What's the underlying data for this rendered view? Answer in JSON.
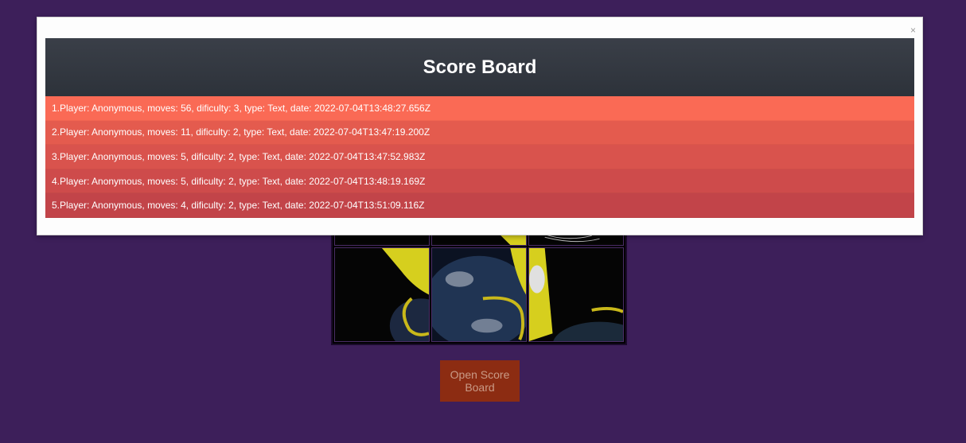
{
  "scoreboard": {
    "title": "Score Board",
    "close_label": "×",
    "row_colors": [
      "#fa6a55",
      "#e45b4e",
      "#d9534d",
      "#ce4b4b",
      "#c24449"
    ],
    "entries": [
      "1.Player: Anonymous, moves: 56, dificulty: 3, type: Text, date: 2022-07-04T13:48:27.656Z",
      "2.Player: Anonymous, moves: 11, dificulty: 2, type: Text, date: 2022-07-04T13:47:19.200Z",
      "3.Player: Anonymous, moves: 5, dificulty: 2, type: Text, date: 2022-07-04T13:47:52.983Z",
      "4.Player: Anonymous, moves: 5, dificulty: 2, type: Text, date: 2022-07-04T13:48:19.169Z",
      "5.Player: Anonymous, moves: 4, dificulty: 2, type: Text, date: 2022-07-04T13:51:09.116Z"
    ]
  },
  "game": {
    "open_scoreboard_label": "Open Score\nBoard"
  },
  "colors": {
    "background": "#3d1f5a",
    "button": "#8c2c12",
    "header": "#343a42"
  }
}
